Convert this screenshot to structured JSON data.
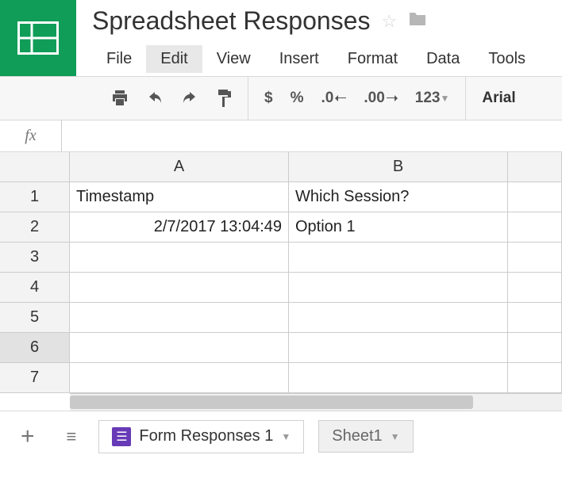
{
  "header": {
    "title": "Spreadsheet Responses"
  },
  "menu": {
    "items": [
      "File",
      "Edit",
      "View",
      "Insert",
      "Format",
      "Data",
      "Tools"
    ],
    "active": "Edit"
  },
  "toolbar": {
    "dollar": "$",
    "percent": "%",
    "dec_dec": ".0",
    "dec_inc": ".00",
    "numfmt": "123",
    "font": "Arial"
  },
  "formula": {
    "label": "fx",
    "value": ""
  },
  "grid": {
    "columns": [
      "A",
      "B"
    ],
    "rows": [
      "1",
      "2",
      "3",
      "4",
      "5",
      "6",
      "7"
    ],
    "selected_row": "6",
    "cells": {
      "A1": "Timestamp",
      "B1": "Which Session?",
      "A2": "2/7/2017 13:04:49",
      "B2": "Option 1"
    }
  },
  "tabs": {
    "active": "Form Responses 1",
    "other": "Sheet1"
  }
}
